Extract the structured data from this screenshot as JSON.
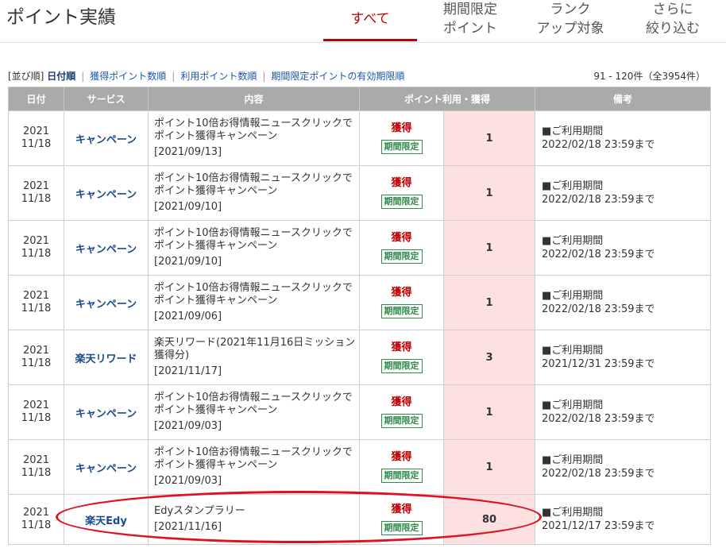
{
  "page": {
    "title": "ポイント実績"
  },
  "tabs": [
    {
      "lines": [
        "すべて"
      ],
      "active": true
    },
    {
      "lines": [
        "期間限定",
        "ポイント"
      ],
      "active": false
    },
    {
      "lines": [
        "ランク",
        "アップ対象"
      ],
      "active": false
    },
    {
      "lines": [
        "さらに",
        "絞り込む"
      ],
      "active": false
    }
  ],
  "sort": {
    "prefix": "[並び順]",
    "current": "日付順",
    "options": [
      "獲得ポイント数順",
      "利用ポイント数順",
      "期間限定ポイントの有効期限順"
    ]
  },
  "range": "91 - 120件（全3954件）",
  "table": {
    "headers": [
      "日付",
      "サービス",
      "内容",
      "ポイント利用・獲得",
      "備考"
    ],
    "rows": [
      {
        "year": "2021",
        "date": "11/18",
        "service": "キャンペーン",
        "content": "ポイント10倍お得情報ニュースクリックでポイント獲得キャンペーン",
        "content_date": "[2021/09/13]",
        "kind": "獲得",
        "badge": "期間限定",
        "amount": "1",
        "note_label": "■ご利用期間",
        "note_value": "2022/02/18 23:59まで"
      },
      {
        "year": "2021",
        "date": "11/18",
        "service": "キャンペーン",
        "content": "ポイント10倍お得情報ニュースクリックでポイント獲得キャンペーン",
        "content_date": "[2021/09/10]",
        "kind": "獲得",
        "badge": "期間限定",
        "amount": "1",
        "note_label": "■ご利用期間",
        "note_value": "2022/02/18 23:59まで"
      },
      {
        "year": "2021",
        "date": "11/18",
        "service": "キャンペーン",
        "content": "ポイント10倍お得情報ニュースクリックでポイント獲得キャンペーン",
        "content_date": "[2021/09/10]",
        "kind": "獲得",
        "badge": "期間限定",
        "amount": "1",
        "note_label": "■ご利用期間",
        "note_value": "2022/02/18 23:59まで"
      },
      {
        "year": "2021",
        "date": "11/18",
        "service": "キャンペーン",
        "content": "ポイント10倍お得情報ニュースクリックでポイント獲得キャンペーン",
        "content_date": "[2021/09/06]",
        "kind": "獲得",
        "badge": "期間限定",
        "amount": "1",
        "note_label": "■ご利用期間",
        "note_value": "2022/02/18 23:59まで"
      },
      {
        "year": "2021",
        "date": "11/18",
        "service": "楽天リワード",
        "content": "楽天リワード(2021年11月16日ミッション獲得分)",
        "content_date": "[2021/11/17]",
        "kind": "獲得",
        "badge": "期間限定",
        "amount": "3",
        "note_label": "■ご利用期間",
        "note_value": "2021/12/31 23:59まで"
      },
      {
        "year": "2021",
        "date": "11/18",
        "service": "キャンペーン",
        "content": "ポイント10倍お得情報ニュースクリックでポイント獲得キャンペーン",
        "content_date": "[2021/09/03]",
        "kind": "獲得",
        "badge": "期間限定",
        "amount": "1",
        "note_label": "■ご利用期間",
        "note_value": "2022/02/18 23:59まで"
      },
      {
        "year": "2021",
        "date": "11/18",
        "service": "キャンペーン",
        "content": "ポイント10倍お得情報ニュースクリックでポイント獲得キャンペーン",
        "content_date": "[2021/09/03]",
        "kind": "獲得",
        "badge": "期間限定",
        "amount": "1",
        "note_label": "■ご利用期間",
        "note_value": "2022/02/18 23:59まで"
      },
      {
        "year": "2021",
        "date": "11/18",
        "service": "楽天Edy",
        "content": "Edyスタンプラリー",
        "content_date": "[2021/11/16]",
        "kind": "獲得",
        "badge": "期間限定",
        "amount": "80",
        "note_label": "■ご利用期間",
        "note_value": "2021/12/17 23:59まで"
      }
    ]
  },
  "colors": {
    "accent": "#bf0000",
    "header_bg": "#aaaaaa",
    "amount_bg": "#fde0e0",
    "badge": "#2f8b4a",
    "highlight": "#e01020"
  }
}
